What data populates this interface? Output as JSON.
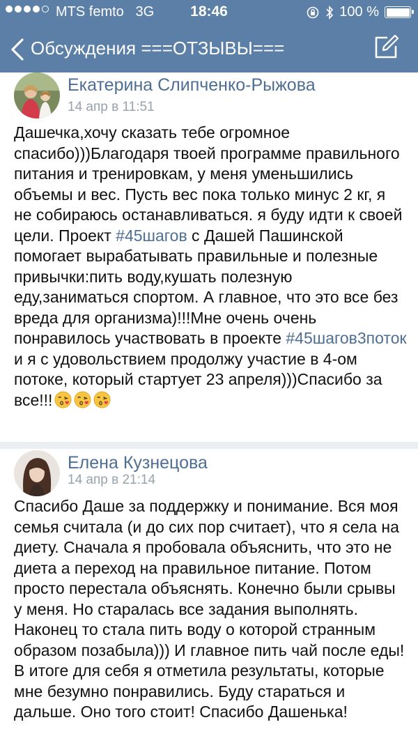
{
  "status_bar": {
    "carrier": "MTS femto",
    "network": "3G",
    "time": "18:46",
    "battery": "100 %",
    "battery_level": 1.0,
    "signal_bars_filled": 4,
    "signal_bars_total": 5
  },
  "nav": {
    "back_label": "Обсуждения",
    "title": "===ОТЗЫВЫ==="
  },
  "colors": {
    "header_bg": "#5b7fa6",
    "link": "#4e6e94",
    "meta": "#98a2ad"
  },
  "posts": [
    {
      "author": "Екатерина Слипченко-Рыжова",
      "date": "14 апр в 11:51",
      "text_part1": "Дашечка,хочу сказать тебе огромное спасибо)))Благодаря твоей программе правильного питания и тренировкам, у меня уменьшились объемы и вес. Пусть вес пока только минус 2 кг, я не собираюсь останавливаться. я буду идти к своей цели. Проект ",
      "hashtag1": "#45шагов",
      "text_part2": " с Дашей Пашинской помогает вырабатывать правильные и полезные привычки:пить воду,кушать полезную еду,заниматься спортом. А главное, что это все без вреда для организма)!!!Мне очень очень понравилось участвовать в проекте ",
      "hashtag2": "#45шагов3поток",
      "text_part3": " и я с удовольствием продолжу участие в 4-ом потоке, который стартует 23 апреля)))Спасибо за все!!!",
      "emoji": "kissing-face-heart-emoji"
    },
    {
      "author": "Елена Кузнецова",
      "date": "14 апр в 21:14",
      "text": "Спасибо Даше за поддержку и понимание. Вся моя семья считала (и до сих пор считает), что я села на диету. Сначала я пробовала объяснить, что это не диета а переход на правильное питание. Потом просто перестала объяснять. Конечно были срывы у меня. Но старалась все задания выполнять. Наконец то стала пить воду о которой странным образом позабыла))) И главное пить чай после еды! В итоге для себя я отметила результаты, которые мне безумно понравились. Буду стараться и дальше. Оно того стоит! Спасибо Дашенька!"
    }
  ]
}
